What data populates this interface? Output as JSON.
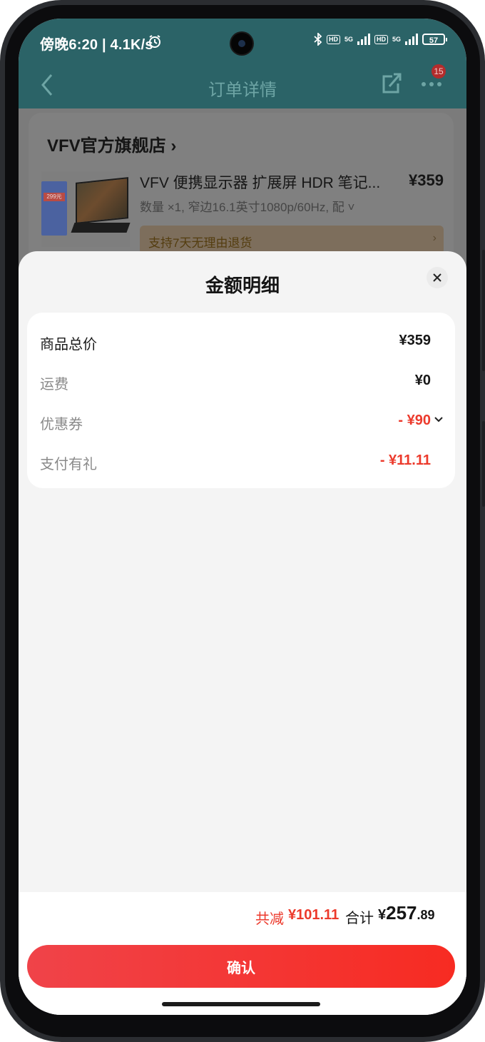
{
  "status_bar": {
    "time": "傍晚6:20 | 4.1K/s",
    "network": "5G",
    "battery": "57"
  },
  "header": {
    "title": "订单详情",
    "notification_count": "15"
  },
  "order": {
    "store_name": "VFV官方旗舰店",
    "product_title": "VFV 便携显示器 扩展屏 HDR 笔记...",
    "product_price": "¥359",
    "product_spec": "数量 ×1, 窄边16.1英寸1080p/60Hz, 配",
    "image_tag_text": "299元",
    "return_policy": "支持7天无理由退货"
  },
  "sheet": {
    "title": "金额明细",
    "rows": [
      {
        "label": "商品总价",
        "value": "¥359"
      },
      {
        "label": "运费",
        "value": "¥0"
      },
      {
        "label": "优惠券",
        "value": "- ¥90"
      },
      {
        "label": "支付有礼",
        "value": "- ¥11.11"
      }
    ]
  },
  "summary": {
    "saved_label": "共减",
    "saved_value": "¥101.11",
    "total_label": "合计",
    "total_currency": "¥",
    "total_int": "257",
    "total_dec": ".89"
  },
  "confirm_label": "确认",
  "colors": {
    "accent_red": "#ec3a2c",
    "header_teal": "#2b6367",
    "button_gradient_start": "#f04349",
    "button_gradient_end": "#f72b22"
  }
}
